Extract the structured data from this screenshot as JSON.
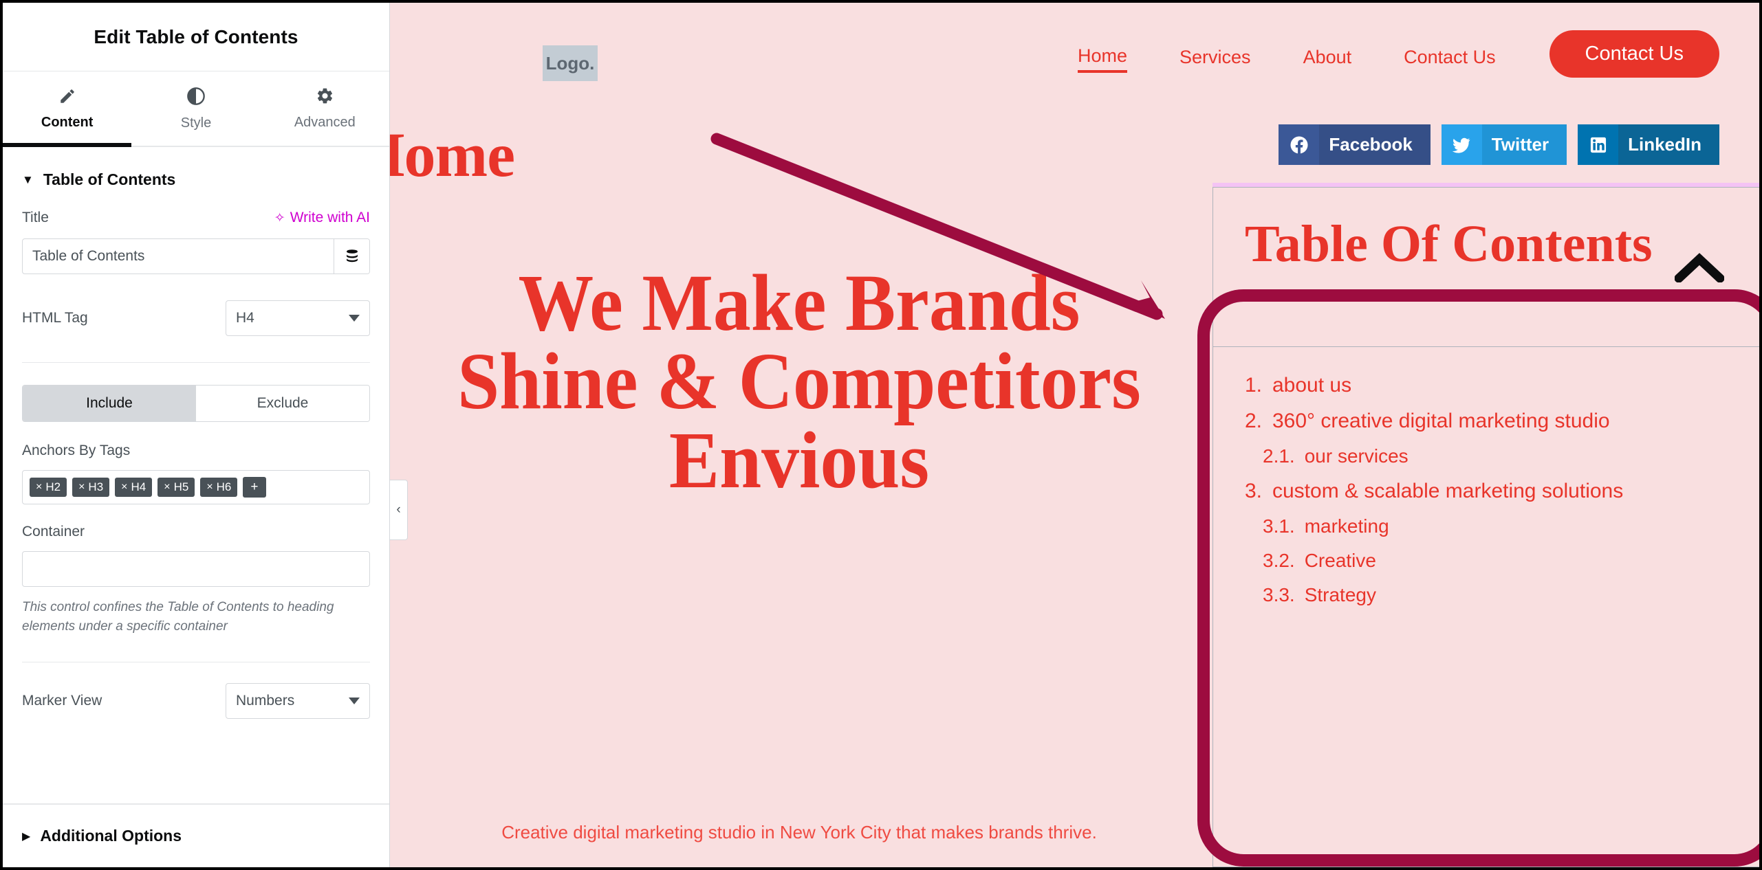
{
  "panel": {
    "title": "Edit Table of Contents",
    "tabs": [
      {
        "label": "Content",
        "icon": "pencil-icon"
      },
      {
        "label": "Style",
        "icon": "contrast-half-circle-icon"
      },
      {
        "label": "Advanced",
        "icon": "gear-icon"
      }
    ],
    "section": {
      "label": "Table of Contents",
      "state": "expanded"
    },
    "controls": {
      "title_label": "Title",
      "ai_link": "Write with AI",
      "ai_icon": "sparkle-icon",
      "title_value": "Table of Contents",
      "title_placeholder": "Table of Contents",
      "dynamic_tags_icon": "database-icon",
      "html_tag_label": "HTML Tag",
      "html_tag_value": "H4",
      "include_exclude": {
        "include": "Include",
        "exclude": "Exclude",
        "selected": "Include"
      },
      "anchors_label": "Anchors By Tags",
      "anchor_tags": [
        "H2",
        "H3",
        "H4",
        "H5",
        "H6"
      ],
      "anchor_add": "+",
      "container_label": "Container",
      "container_value": "",
      "container_hint": "This control confines the Table of Contents to heading elements under a specific container",
      "marker_view_label": "Marker View",
      "marker_view_value": "Numbers"
    },
    "additional_options": {
      "label": "Additional Options",
      "state": "collapsed"
    },
    "collapse_handle_icon": "chevron-left-icon"
  },
  "site": {
    "logo_text": "Logo.",
    "nav": [
      {
        "label": "Home",
        "current": true
      },
      {
        "label": "Services",
        "current": false
      },
      {
        "label": "About",
        "current": false
      },
      {
        "label": "Contact Us",
        "current": false
      }
    ],
    "cta_label": "Contact Us",
    "socials": [
      {
        "label": "Facebook",
        "icon": "facebook-icon",
        "color": "#3b5897"
      },
      {
        "label": "Twitter",
        "icon": "twitter-bird-icon",
        "color": "#29a3eb"
      },
      {
        "label": "LinkedIn",
        "icon": "linkedin-icon",
        "color": "#0073b0"
      }
    ],
    "page_word": "Home",
    "hero_heading": "We Make Brands Shine & Competitors Envious",
    "hero_sub": "Creative digital marketing studio in New York City that makes brands thrive."
  },
  "toc": {
    "title": "Table Of Contents",
    "toggle_icon": "chevron-up-icon",
    "items": [
      {
        "num": "1.",
        "label": "about us",
        "level": 1
      },
      {
        "num": "2.",
        "label": "360° creative digital marketing studio",
        "level": 1
      },
      {
        "num": "2.1.",
        "label": "our services",
        "level": 2
      },
      {
        "num": "3.",
        "label": "custom & scalable marketing solutions",
        "level": 1
      },
      {
        "num": "3.1.",
        "label": "marketing",
        "level": 2
      },
      {
        "num": "3.2.",
        "label": "Creative",
        "level": 2
      },
      {
        "num": "3.3.",
        "label": "Strategy",
        "level": 2
      }
    ]
  },
  "annotation": {
    "arrow_color": "#9d0c3f",
    "highlight_color": "#9d0c3f"
  },
  "colors": {
    "brand_red": "#e8342a",
    "page_bg": "#f9dfe0",
    "ai_magenta": "#cf00cf",
    "panel_text": "#495157"
  }
}
